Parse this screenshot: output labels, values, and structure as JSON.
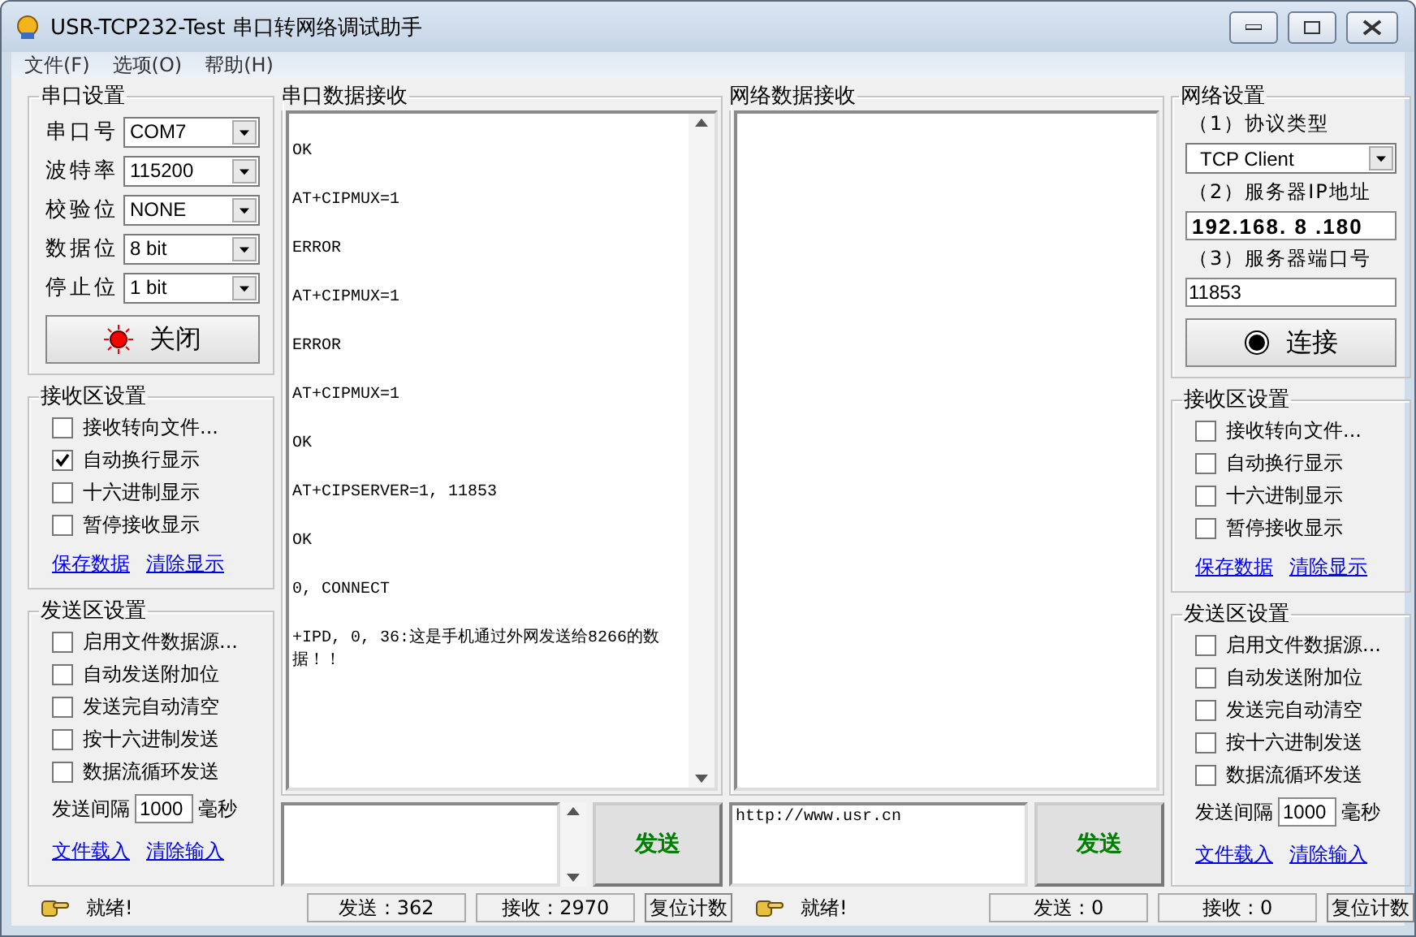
{
  "window": {
    "title": "USR-TCP232-Test 串口转网络调试助手"
  },
  "menu": [
    "文件(F)",
    "选项(O)",
    "帮助(H)"
  ],
  "serial_settings": {
    "title": "串口设置",
    "fields": [
      {
        "label": "串口号",
        "value": "COM7"
      },
      {
        "label": "波特率",
        "value": "115200"
      },
      {
        "label": "校验位",
        "value": "NONE"
      },
      {
        "label": "数据位",
        "value": "8 bit"
      },
      {
        "label": "停止位",
        "value": "1 bit"
      }
    ],
    "button": "关闭"
  },
  "serial_receive_settings": {
    "title": "接收区设置",
    "options": [
      {
        "label": "接收转向文件...",
        "checked": false
      },
      {
        "label": "自动换行显示",
        "checked": true
      },
      {
        "label": "十六进制显示",
        "checked": false
      },
      {
        "label": "暂停接收显示",
        "checked": false
      }
    ],
    "links": [
      "保存数据",
      "清除显示"
    ]
  },
  "serial_send_settings": {
    "title": "发送区设置",
    "options": [
      {
        "label": "启用文件数据源...",
        "checked": false
      },
      {
        "label": "自动发送附加位",
        "checked": false
      },
      {
        "label": "发送完自动清空",
        "checked": false
      },
      {
        "label": "按十六进制发送",
        "checked": false
      },
      {
        "label": "数据流循环发送",
        "checked": false
      }
    ],
    "interval_label": "发送间隔",
    "interval": "1000",
    "interval_unit": "毫秒",
    "links": [
      "文件载入",
      "清除输入"
    ]
  },
  "serial_receive": {
    "title": "串口数据接收",
    "lines": [
      "OK",
      "AT+CIPMUX=1",
      "ERROR",
      "AT+CIPMUX=1",
      "ERROR",
      "AT+CIPMUX=1",
      "OK",
      "AT+CIPSERVER=1, 11853",
      "OK",
      "0, CONNECT",
      "+IPD, 0, 36:这是手机通过外网发送给8266的数据！！"
    ]
  },
  "serial_send": {
    "button": "发送"
  },
  "serial_status": {
    "status": "就绪!",
    "sent": "发送 : 362",
    "received": "接收 : 2970",
    "reset": "复位计数"
  },
  "network_receive": {
    "title": "网络数据接收"
  },
  "network_send": {
    "value": "http://www.usr.cn",
    "button": "发送"
  },
  "network_status": {
    "status": "就绪!",
    "sent": "发送 : 0",
    "received": "接收 : 0",
    "reset": "复位计数"
  },
  "network_settings": {
    "title": "网络设置",
    "protocol_label": "（1）协议类型",
    "protocol": "TCP Client",
    "ip_label": "（2）服务器IP地址",
    "ip": "192.168. 8 .180",
    "port_label": "（3）服务器端口号",
    "port": "11853",
    "button": "连接"
  },
  "network_receive_settings": {
    "title": "接收区设置",
    "options": [
      {
        "label": "接收转向文件...",
        "checked": false
      },
      {
        "label": "自动换行显示",
        "checked": false
      },
      {
        "label": "十六进制显示",
        "checked": false
      },
      {
        "label": "暂停接收显示",
        "checked": false
      }
    ],
    "links": [
      "保存数据",
      "清除显示"
    ]
  },
  "network_send_settings": {
    "title": "发送区设置",
    "options": [
      {
        "label": "启用文件数据源...",
        "checked": false
      },
      {
        "label": "自动发送附加位",
        "checked": false
      },
      {
        "label": "发送完自动清空",
        "checked": false
      },
      {
        "label": "按十六进制发送",
        "checked": false
      },
      {
        "label": "数据流循环发送",
        "checked": false
      }
    ],
    "interval_label": "发送间隔",
    "interval": "1000",
    "interval_unit": "毫秒",
    "links": [
      "文件载入",
      "清除输入"
    ]
  }
}
